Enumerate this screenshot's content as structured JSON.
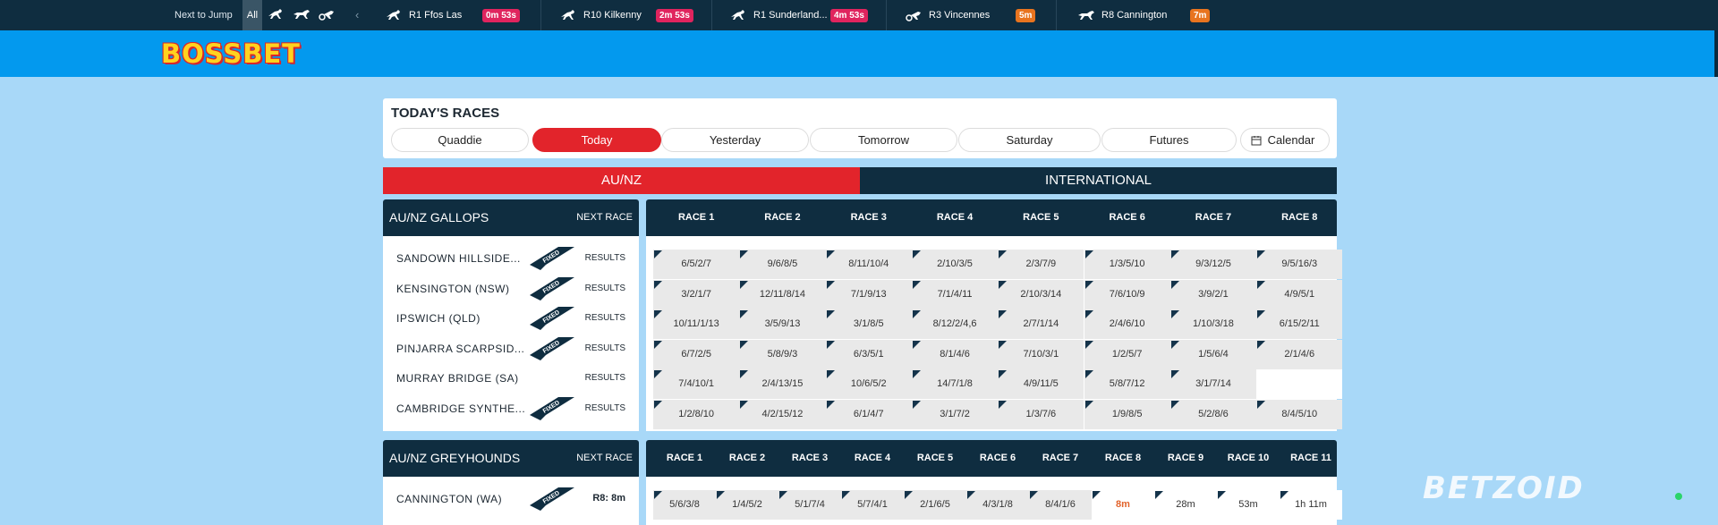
{
  "ntj": {
    "label": "Next to Jump",
    "all": "All",
    "items": [
      {
        "name": "R1  Ffos Las",
        "timer": "0m 53s",
        "color": "#e0245e"
      },
      {
        "name": "R10  Kilkenny",
        "timer": "2m 53s",
        "color": "#e0245e"
      },
      {
        "name": "R1  Sunderland...",
        "timer": "4m 53s",
        "color": "#e0245e"
      },
      {
        "name": "R3  Vincennes",
        "timer": "5m",
        "color": "#e8741f"
      },
      {
        "name": "R8  Cannington",
        "timer": "7m",
        "color": "#e8741f"
      }
    ]
  },
  "brand": {
    "logo": "BOSSBET"
  },
  "today": {
    "title": "TODAY'S RACES",
    "tabs": [
      "Quaddie",
      "Today",
      "Yesterday",
      "Tomorrow",
      "Saturday",
      "Futures",
      "Calendar"
    ]
  },
  "regions": {
    "aunz": "AU/NZ",
    "intl": "INTERNATIONAL"
  },
  "gallops": {
    "title": "AU/NZ GALLOPS",
    "next": "NEXT RACE",
    "races": [
      "RACE 1",
      "RACE 2",
      "RACE 3",
      "RACE 4",
      "RACE 5",
      "RACE 6",
      "RACE 7",
      "RACE 8"
    ],
    "meetings": [
      {
        "name": "SANDOWN HILLSIDE...",
        "fixed": true,
        "status": "RESULTS",
        "cells": [
          "6/5/2/7",
          "9/6/8/5",
          "8/11/10/4",
          "2/10/3/5",
          "2/3/7/9",
          "1/3/5/10",
          "9/3/12/5",
          "9/5/16/3"
        ]
      },
      {
        "name": "KENSINGTON (NSW)",
        "fixed": true,
        "status": "RESULTS",
        "cells": [
          "3/2/1/7",
          "12/11/8/14",
          "7/1/9/13",
          "7/1/4/11",
          "2/10/3/14",
          "7/6/10/9",
          "3/9/2/1",
          "4/9/5/1"
        ]
      },
      {
        "name": "IPSWICH (QLD)",
        "fixed": true,
        "status": "RESULTS",
        "cells": [
          "10/11/1/13",
          "3/5/9/13",
          "3/1/8/5",
          "8/12/2/4,6",
          "2/7/1/14",
          "2/4/6/10",
          "1/10/3/18",
          "6/15/2/11"
        ]
      },
      {
        "name": "PINJARRA SCARPSID...",
        "fixed": true,
        "status": "RESULTS",
        "cells": [
          "6/7/2/5",
          "5/8/9/3",
          "6/3/5/1",
          "8/1/4/6",
          "7/10/3/1",
          "1/2/5/7",
          "1/5/6/4",
          "2/1/4/6"
        ]
      },
      {
        "name": "MURRAY BRIDGE (SA)",
        "fixed": false,
        "status": "RESULTS",
        "cells": [
          "7/4/10/1",
          "2/4/13/15",
          "10/6/5/2",
          "14/7/1/8",
          "4/9/11/5",
          "5/8/7/12",
          "3/1/7/14",
          ""
        ]
      },
      {
        "name": "CAMBRIDGE SYNTHE...",
        "fixed": true,
        "status": "RESULTS",
        "cells": [
          "1/2/8/10",
          "4/2/15/12",
          "6/1/4/7",
          "3/1/7/2",
          "1/3/7/6",
          "1/9/8/5",
          "5/2/8/6",
          "8/4/5/10"
        ]
      }
    ]
  },
  "greyhounds": {
    "title": "AU/NZ GREYHOUNDS",
    "next": "NEXT RACE",
    "races": [
      "RACE 1",
      "RACE 2",
      "RACE 3",
      "RACE 4",
      "RACE 5",
      "RACE 6",
      "RACE 7",
      "RACE 8",
      "RACE 9",
      "RACE 10",
      "RACE 11"
    ],
    "meetings": [
      {
        "name": "CANNINGTON (WA)",
        "fixed": true,
        "status": "R8: 8m",
        "cells": [
          "5/6/3/8",
          "1/4/5/2",
          "5/1/7/4",
          "5/7/4/1",
          "2/1/6/5",
          "4/3/1/8",
          "8/4/1/6",
          "8m",
          "28m",
          "53m",
          "1h 11m"
        ]
      }
    ]
  },
  "watermark": "BETZOID",
  "colors": {
    "accent_red": "#e2242b",
    "navy": "#0f2d40",
    "brand_blue": "#0399ee",
    "page_bg": "#a8d8f8"
  }
}
